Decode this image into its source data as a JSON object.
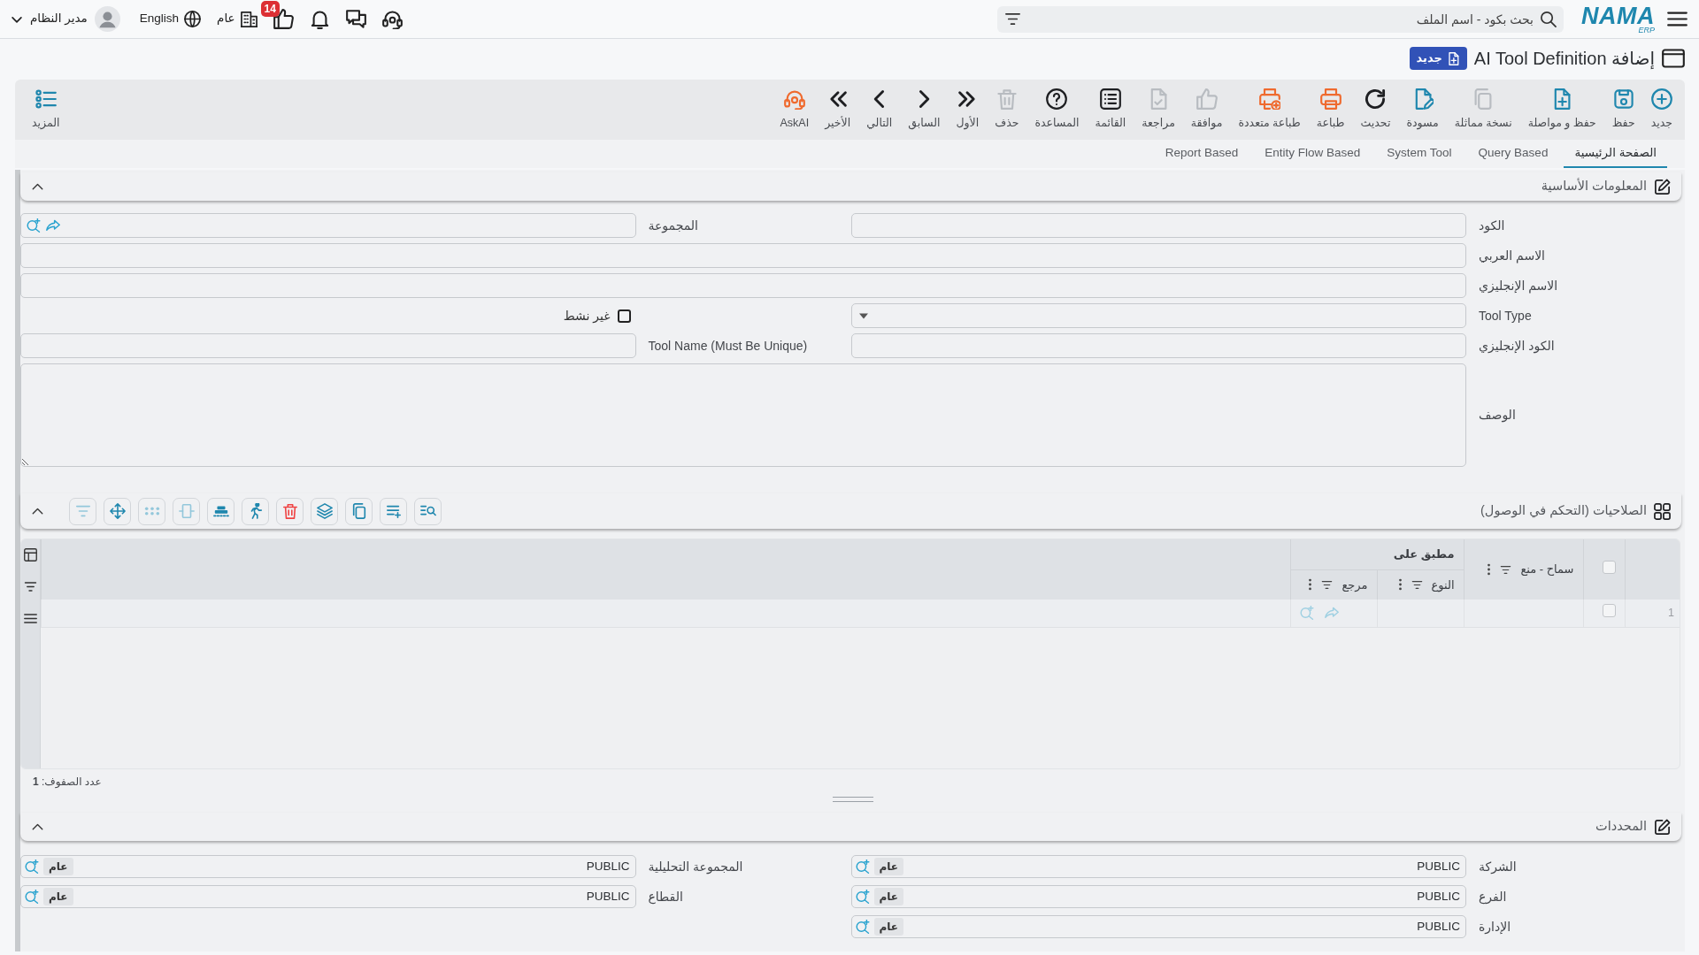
{
  "top_bar": {
    "logo": {
      "text": "NAMA",
      "sub": "ERP"
    },
    "search": {
      "placeholder": "بحث بكود - اسم الملف"
    },
    "badge_count": "14",
    "company": "عام",
    "language": "English",
    "user": {
      "name": "مدير النظام"
    }
  },
  "title": {
    "text": "إضافة AI Tool Definition",
    "badge": "جديد"
  },
  "toolbar": {
    "buttons": [
      {
        "kind": "new",
        "label": "جديد",
        "disabled": false
      },
      {
        "kind": "save",
        "label": "حفظ",
        "disabled": false
      },
      {
        "kind": "continue",
        "label": "حفظ و مواصلة",
        "disabled": false
      },
      {
        "kind": "duplicate",
        "label": "نسخة مماثلة",
        "disabled": true
      },
      {
        "kind": "draft",
        "label": "مسودة",
        "disabled": false
      },
      {
        "kind": "refresh",
        "label": "تحديث",
        "disabled": false
      },
      {
        "kind": "print",
        "label": "طباعة",
        "disabled": false
      },
      {
        "kind": "multiprint",
        "label": "طباعة متعددة",
        "disabled": false
      },
      {
        "kind": "approve",
        "label": "موافقة",
        "disabled": true
      },
      {
        "kind": "review",
        "label": "مراجعة",
        "disabled": true
      },
      {
        "kind": "list",
        "label": "القائمة",
        "disabled": false
      },
      {
        "kind": "help",
        "label": "المساعدة",
        "disabled": false
      },
      {
        "kind": "delete",
        "label": "حذف",
        "disabled": true
      },
      {
        "kind": "first",
        "label": "الأول",
        "disabled": false
      },
      {
        "kind": "previous",
        "label": "السابق",
        "disabled": false
      },
      {
        "kind": "next",
        "label": "التالي",
        "disabled": false
      },
      {
        "kind": "last",
        "label": "الأخير",
        "disabled": false
      },
      {
        "kind": "askai",
        "label": "AskAI",
        "disabled": false
      }
    ],
    "more": {
      "label": "المزيد"
    }
  },
  "tabs": [
    {
      "label": "الصفحة الرئيسية",
      "selected": true
    },
    {
      "label": "Query Based",
      "selected": false
    },
    {
      "label": "System Tool",
      "selected": false
    },
    {
      "label": "Entity Flow Based",
      "selected": false
    },
    {
      "label": "Report Based",
      "selected": false
    }
  ],
  "sections": [
    {
      "kind": "form",
      "title": "المعلومات الأساسية",
      "expanded": true,
      "rows": [
        [
          {
            "label": "الكود",
            "kind": "text"
          },
          {
            "label": "المجموعة",
            "kind": "lookup"
          }
        ],
        [
          {
            "label": "الاسم العربي",
            "kind": "text"
          }
        ],
        [
          {
            "label": "الاسم الإنجليزي",
            "kind": "text"
          }
        ],
        [
          {
            "label": "Tool Type",
            "kind": "select"
          },
          {
            "label": "غير نشط",
            "kind": "checkbox",
            "checked": false
          }
        ],
        [
          {
            "label": "الكود الإنجليزي",
            "kind": "text"
          },
          {
            "label": "Tool Name (Must Be Unique)",
            "kind": "text"
          }
        ],
        [
          {
            "label": "الوصف",
            "kind": "textarea"
          }
        ]
      ]
    },
    {
      "kind": "grid",
      "title": "الصلاحيات (التحكم في الوصول)",
      "expanded": true,
      "tools": [
        {
          "kind": "listsearch",
          "disabled": false
        },
        {
          "kind": "listplus",
          "disabled": false
        },
        {
          "kind": "copy",
          "disabled": false
        },
        {
          "kind": "layers",
          "disabled": false
        },
        {
          "kind": "trash",
          "disabled": false
        },
        {
          "kind": "runner",
          "disabled": false
        },
        {
          "kind": "bars",
          "disabled": false
        },
        {
          "kind": "columns",
          "disabled": true
        },
        {
          "kind": "dots",
          "disabled": true
        },
        {
          "kind": "move",
          "disabled": false
        },
        {
          "kind": "filter",
          "disabled": true
        }
      ],
      "grid": {
        "all_checked": false,
        "columns": [
          {
            "label": "سماح - منع",
            "kind": "text"
          }
        ],
        "group": {
          "label": "مطبق على",
          "columns": [
            {
              "label": "النوع",
              "kind": "text"
            },
            {
              "label": "مرجع",
              "kind": "lookup"
            }
          ]
        },
        "rows": [
          {
            "number": "1",
            "checked": false
          }
        ],
        "footer": "عدد الصفوف: **1**"
      }
    },
    {
      "kind": "filters",
      "title": "المحددات",
      "expanded": true,
      "rows": [
        [
          {
            "label": "الشركة",
            "value": "PUBLIC",
            "tag": "عام"
          },
          {
            "label": "المجموعة التحليلية",
            "value": "PUBLIC",
            "tag": "عام"
          }
        ],
        [
          {
            "label": "الفرع",
            "value": "PUBLIC",
            "tag": "عام"
          },
          {
            "label": "القطاع",
            "value": "PUBLIC",
            "tag": "عام"
          }
        ],
        [
          {
            "label": "الإدارة",
            "value": "PUBLIC",
            "tag": "عام"
          }
        ]
      ]
    }
  ]
}
